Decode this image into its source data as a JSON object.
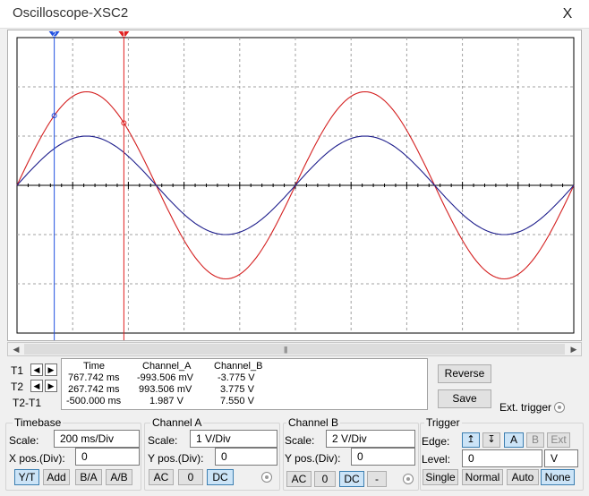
{
  "window": {
    "title": "Oscilloscope-XSC2",
    "close": "X"
  },
  "cursors": {
    "c1_label": "1",
    "c2_label": "2"
  },
  "readout": {
    "headers": [
      "Time",
      "Channel_A",
      "Channel_B"
    ],
    "rows": [
      {
        "label": "T1",
        "time": "767.742 ms",
        "cha": "-993.506 mV",
        "chb": "-3.775 V"
      },
      {
        "label": "T2",
        "time": "267.742 ms",
        "cha": "993.506 mV",
        "chb": "3.775 V"
      },
      {
        "label": "T2-T1",
        "time": "-500.000 ms",
        "cha": "1.987 V",
        "chb": "7.550 V"
      }
    ]
  },
  "side_buttons": {
    "reverse": "Reverse",
    "save": "Save",
    "ext_trigger": "Ext. trigger"
  },
  "timebase": {
    "title": "Timebase",
    "scale_label": "Scale:",
    "scale": "200 ms/Div",
    "xpos_label": "X pos.(Div):",
    "xpos": "0",
    "modes": [
      "Y/T",
      "Add",
      "B/A",
      "A/B"
    ],
    "active_mode": "Y/T"
  },
  "channel_a": {
    "title": "Channel A",
    "scale_label": "Scale:",
    "scale": "1  V/Div",
    "ypos_label": "Y pos.(Div):",
    "ypos": "0",
    "coupling": [
      "AC",
      "0",
      "DC"
    ],
    "active_coupling": "DC"
  },
  "channel_b": {
    "title": "Channel B",
    "scale_label": "Scale:",
    "scale": "2  V/Div",
    "ypos_label": "Y pos.(Div):",
    "ypos": "0",
    "coupling": [
      "AC",
      "0",
      "DC",
      "-"
    ],
    "active_coupling": "DC"
  },
  "trigger": {
    "title": "Trigger",
    "edge_label": "Edge:",
    "edge_icons": [
      "rising-edge-icon",
      "falling-edge-icon"
    ],
    "sources": [
      "A",
      "B",
      "Ext"
    ],
    "active_source": "A",
    "level_label": "Level:",
    "level": "0",
    "level_unit": "V",
    "modes": [
      "Single",
      "Normal",
      "Auto",
      "None"
    ],
    "active_mode": "None"
  },
  "colors": {
    "trace_a": "#d42020",
    "trace_b": "#1e1e8c",
    "cursor1": "#e02020",
    "cursor2": "#2050e0",
    "grid": "#a0a0a0"
  },
  "chart_data": {
    "type": "line",
    "x_unit": "ms",
    "xlim": [
      0,
      2000
    ],
    "series": [
      {
        "name": "Channel A",
        "amplitude_div": 1.9,
        "period_ms": 1000,
        "phase": "sine"
      },
      {
        "name": "Channel B",
        "amplitude_div": 1.0,
        "period_ms": 1000,
        "phase": "sine"
      }
    ]
  }
}
